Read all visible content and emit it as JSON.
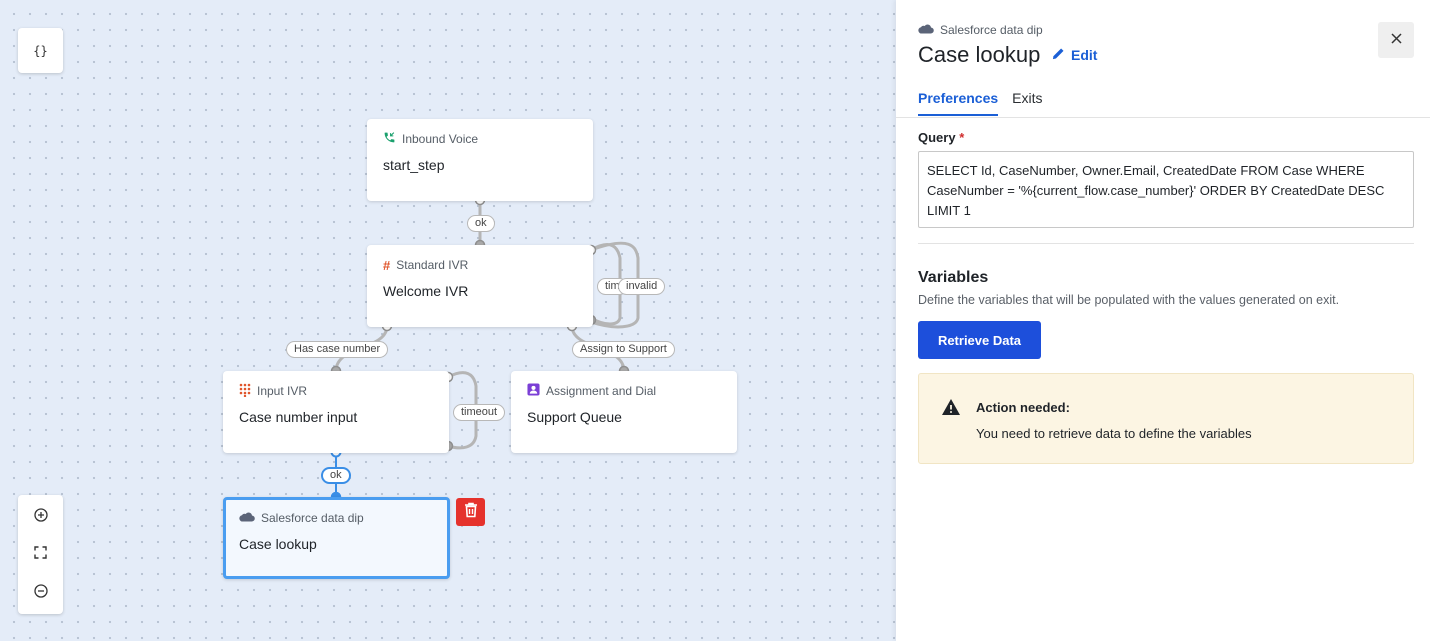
{
  "canvas": {
    "json_button_label": "{}",
    "nodes": [
      {
        "type": "Inbound Voice",
        "title": "start_step",
        "icon": "phone-incoming-icon"
      },
      {
        "type": "Standard IVR",
        "title": "Welcome IVR",
        "icon": "hash-icon"
      },
      {
        "type": "Input IVR",
        "title": "Case number input",
        "icon": "keypad-icon"
      },
      {
        "type": "Assignment and Dial",
        "title": "Support Queue",
        "icon": "assignment-icon"
      },
      {
        "type": "Salesforce data dip",
        "title": "Case lookup",
        "icon": "salesforce-cloud-icon"
      }
    ],
    "edge_labels": {
      "start_ok": "ok",
      "timeout_partial": "tim",
      "invalid": "invalid",
      "has_case_number": "Has case number",
      "assign_to_support": "Assign to Support",
      "input_timeout": "timeout",
      "input_ok": "ok"
    },
    "colors": {
      "selected_border": "#4a9df0",
      "delete": "#e5322c",
      "canvas_bg": "#e4ecf8"
    }
  },
  "panel": {
    "subtitle": "Salesforce data dip",
    "title": "Case lookup",
    "edit_label": "Edit",
    "tabs": [
      {
        "label": "Preferences",
        "active": true
      },
      {
        "label": "Exits",
        "active": false
      }
    ],
    "query_label": "Query",
    "required_mark": "*",
    "query_value": "SELECT Id, CaseNumber, Owner.Email, CreatedDate FROM Case WHERE CaseNumber = '%{current_flow.case_number}' ORDER BY CreatedDate DESC LIMIT 1",
    "variables_title": "Variables",
    "variables_desc": "Define the variables that will be populated with the values generated on exit.",
    "retrieve_button": "Retrieve Data",
    "alert_title": "Action needed:",
    "alert_text": "You need to retrieve data to define the variables",
    "colors": {
      "accent": "#1b5fd6",
      "button": "#1d4fdb",
      "alert_bg": "#fcf5e3"
    }
  }
}
